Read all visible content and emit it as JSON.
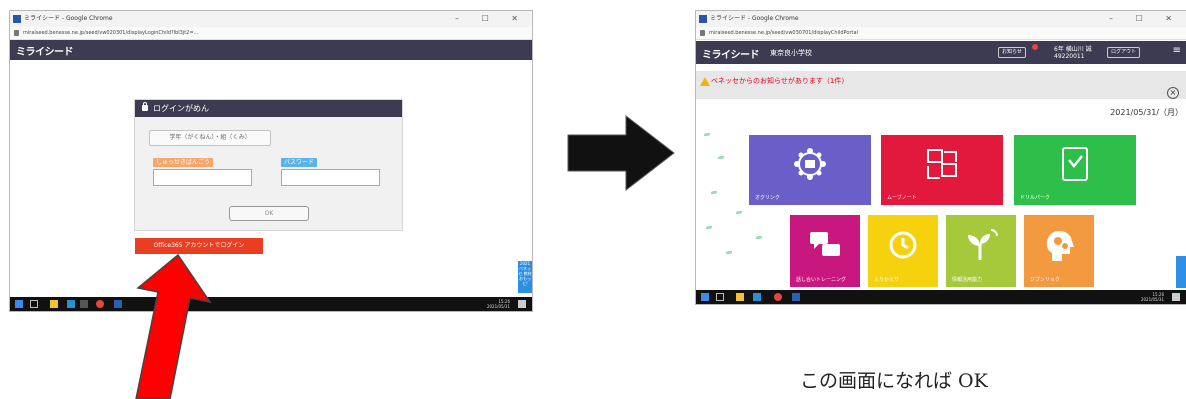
{
  "left_screen": {
    "window_title": "ミライシード - Google Chrome",
    "url": "miraiseed.benesse.ne.jp/seed/vw020301/displayLoginChild?lbl3jt2=...",
    "app_logo": "ミライシード",
    "dialog_title": "ログインがめん",
    "grade_class_button": "学年（がくねん）・組（くみ）",
    "id_label": "しゅっせきばんごう",
    "password_label": "パスワード",
    "ok_button": "OK",
    "office365_button": "Office365 アカウントでログイン",
    "side_widget": "2021 ペネッセ 教材 おもっと!"
  },
  "right_screen": {
    "window_title": "ミライシード - Google Chrome",
    "url": "miraiseed.benesse.ne.jp/seed/vw030701/displayChildPortal",
    "app_logo": "ミライシード",
    "school_name": "東奈良小学校",
    "notice_button": "お知らせ",
    "user_grade": "6年 横山川 誠",
    "user_id": "49220011",
    "logout_button": "ログアウト",
    "notice_message": "ベネッセからのお知らせがあります（1件）",
    "date": "2021/05/31/（月）",
    "tiles": [
      {
        "label": "オクリンク",
        "color": "#6a5fc8"
      },
      {
        "label": "ムーブノート",
        "color": "#e2193c"
      },
      {
        "label": "ドリルパーク",
        "color": "#2ebf4a"
      },
      {
        "label": "話し合いトレーニング",
        "color": "#c8177f"
      },
      {
        "label": "ふりかえり",
        "color": "#f6d10e"
      },
      {
        "label": "情報活用能力",
        "color": "#a6c93b"
      },
      {
        "label": "ジブンリョク",
        "color": "#f39a41"
      }
    ]
  },
  "tray_time_left": "15:26",
  "tray_date_left": "2021/05/31",
  "tray_time_right": "15:26",
  "tray_date_right": "2021/05/31",
  "caption": "この画面になれば OK",
  "colors": {
    "app_bar": "#3c3b52",
    "arrow_black": "#111111",
    "arrow_red": "#ff0000"
  }
}
